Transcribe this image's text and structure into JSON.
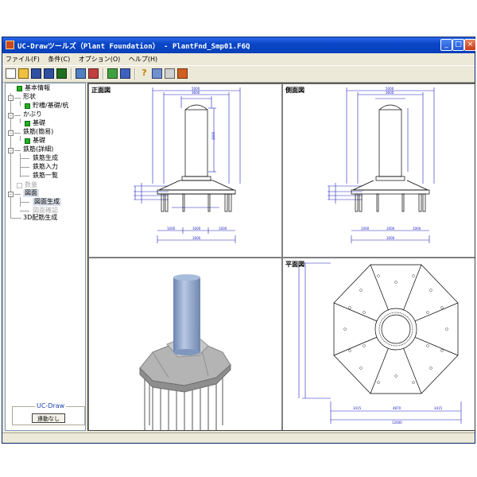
{
  "window": {
    "title": "UC-Drawツールズ（Plant Foundation） - PlantFnd_Smp01.F6Q"
  },
  "menu": [
    "ファイル(F)",
    "条件(C)",
    "オプション(O)",
    "ヘルプ(H)"
  ],
  "tree": {
    "items": [
      {
        "label": "基本情報"
      },
      {
        "label": "形状"
      },
      {
        "label": "貯槽/基礎/杭"
      },
      {
        "label": "かぶり"
      },
      {
        "label": "基礎"
      },
      {
        "label": "鉄筋(簡易)"
      },
      {
        "label": "基礎"
      },
      {
        "label": "鉄筋(詳細)"
      },
      {
        "label": "鉄筋生成"
      },
      {
        "label": "鉄筋入力"
      },
      {
        "label": "鉄筋一覧"
      },
      {
        "label": "数量"
      },
      {
        "label": "図面"
      },
      {
        "label": "図面生成"
      },
      {
        "label": "図面確認"
      },
      {
        "label": "3D配筋生成"
      }
    ]
  },
  "uc_draw": {
    "group_label": "UC-Draw",
    "button_label": "連動なし"
  },
  "views": {
    "front": "正面図",
    "side": "側面図",
    "plan": "平面図"
  },
  "colors": {
    "titlebar": "#0a46c8",
    "dim_line": "#2020c0",
    "column_3d": "#8aa0c4",
    "base_3d": "#a0a0a0"
  }
}
